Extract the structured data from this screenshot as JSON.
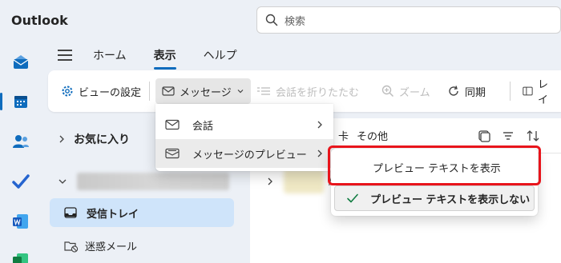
{
  "app": {
    "title": "Outlook"
  },
  "search": {
    "placeholder": "検索"
  },
  "tabs": [
    {
      "label": "ホーム"
    },
    {
      "label": "表示",
      "active": true
    },
    {
      "label": "ヘルプ"
    }
  ],
  "ribbon": {
    "view_settings": "ビューの設定",
    "message": "メッセージ",
    "fold_conversations": "会話を折りたたむ",
    "zoom": "ズーム",
    "sync": "同期",
    "layout": "レイ"
  },
  "dropdown": {
    "items": [
      {
        "label": "会話"
      },
      {
        "label": "メッセージのプレビュー"
      }
    ]
  },
  "submenu": {
    "show_preview": "プレビュー テキストを表示",
    "hide_preview": "プレビュー テキストを表示しない"
  },
  "folders": {
    "favorites": "お気に入り",
    "inbox": "受信トレイ",
    "junk": "迷惑メール"
  },
  "maillist": {
    "partial_tab": "卡",
    "other_tab": "その他",
    "partial_char": "/"
  },
  "colors": {
    "accent": "#0f6cbd",
    "highlight": "#e8141b"
  }
}
